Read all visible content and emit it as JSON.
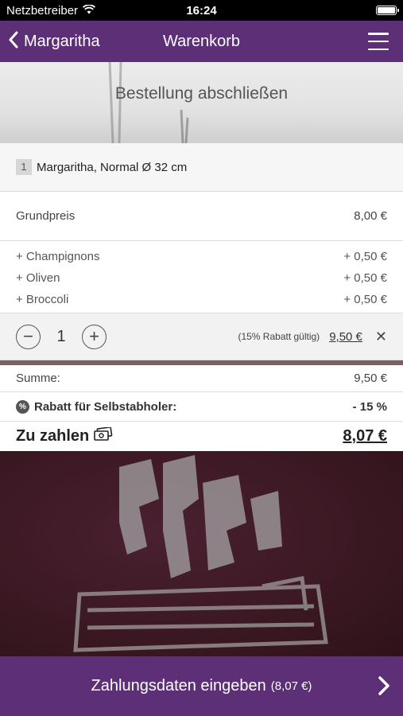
{
  "status_bar": {
    "carrier": "Netzbetreiber",
    "time": "16:24"
  },
  "nav": {
    "back_label": "Margaritha",
    "title": "Warenkorb"
  },
  "banner": {
    "title": "Bestellung abschließen"
  },
  "item": {
    "quantity_badge": "1",
    "name": "Margaritha, Normal Ø 32 cm",
    "base_label": "Grundpreis",
    "base_price": "8,00 €",
    "extras": [
      {
        "label": "+ Champignons",
        "price": "+ 0,50 €"
      },
      {
        "label": "+ Oliven",
        "price": "+ 0,50 €"
      },
      {
        "label": "+ Broccoli",
        "price": "+ 0,50 €"
      }
    ],
    "stepper": {
      "minus": "−",
      "value": "1",
      "plus": "+"
    },
    "discount_note": "(15% Rabatt gültig)",
    "line_total": "9,50 €",
    "remove": "✕"
  },
  "summary": {
    "sum_label": "Summe:",
    "sum_value": "9,50 €",
    "rabatt_label": "Rabatt für Selbstabholer:",
    "rabatt_value": "- 15 %",
    "total_label": "Zu zahlen",
    "total_value": "8,07 €"
  },
  "footer": {
    "label": "Zahlungsdaten eingeben",
    "amount": "(8,07 €)"
  },
  "colors": {
    "brand_purple": "#5d2f77",
    "status_bar": "#000000"
  },
  "icons": [
    "wifi-icon",
    "battery-icon",
    "chevron-left-icon",
    "hamburger-menu-icon",
    "percent-badge-icon",
    "cash-icon",
    "chevron-right-icon"
  ]
}
